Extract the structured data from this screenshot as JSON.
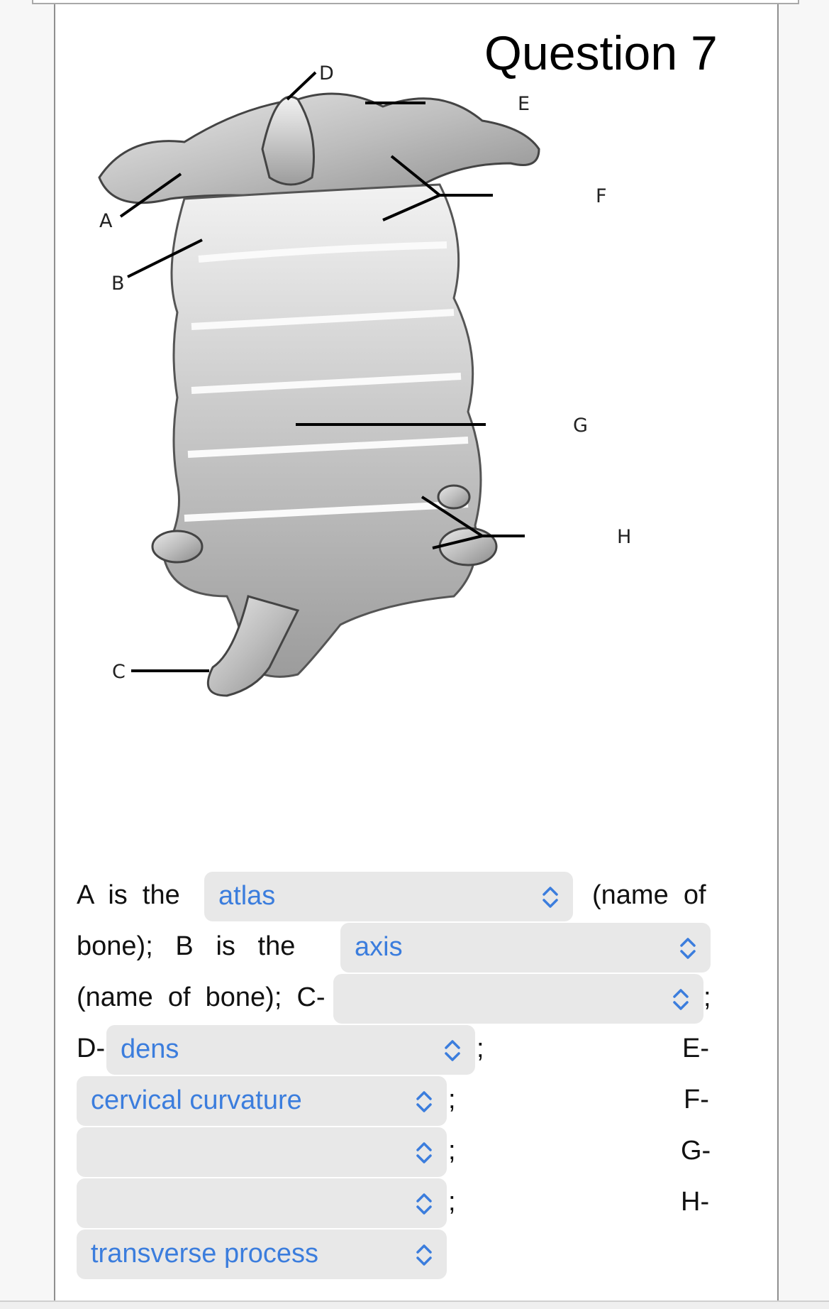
{
  "page": {
    "title": "Question 7"
  },
  "figure": {
    "description": "Cervical vertebrae illustration with labeled parts",
    "labels": [
      "A",
      "B",
      "C",
      "D",
      "E",
      "F",
      "G",
      "H"
    ]
  },
  "question": {
    "text_a_prefix": "A  is  the",
    "text_a_suffix": "(name  of",
    "text_b_prefix": "bone);   B   is   the",
    "text_c_prefix": "(name  of  bone);  C-",
    "text_d_prefix": "D-",
    "semicolon": ";",
    "label_e": "E-",
    "label_f": "F-",
    "label_g": "G-",
    "label_h": "H-",
    "selects": {
      "a": {
        "value": "atlas"
      },
      "b": {
        "value": "axis"
      },
      "c": {
        "value": ""
      },
      "d": {
        "value": "dens"
      },
      "e": {
        "value": "cervical curvature"
      },
      "f": {
        "value": ""
      },
      "g": {
        "value": ""
      },
      "h": {
        "value": "transverse process"
      }
    }
  },
  "colors": {
    "select_text": "#3b7ddd",
    "select_bg": "#e8e8e8"
  }
}
